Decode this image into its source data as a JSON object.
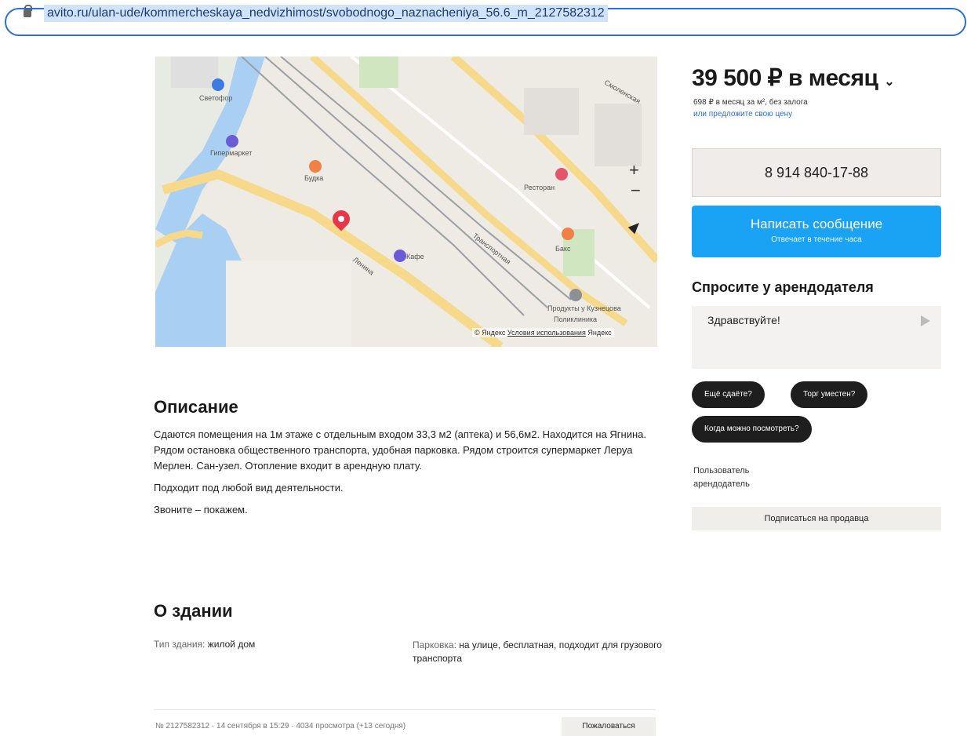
{
  "browser": {
    "url": "avito.ru/ulan-ude/kommercheskaya_nedvizhimost/svobodnogo_naznacheniya_56.6_m_2127582312"
  },
  "map": {
    "labels": [
      "Светофор",
      "Гипермаркет",
      "Будка",
      "Ленина",
      "Кафе",
      "Ресторан",
      "Продукты у Кузнецова",
      "Поликлиника",
      "Бакс",
      "Транспортная",
      "Смоленская"
    ],
    "zoom_in": "+",
    "zoom_out": "−",
    "copyright": "© Яндекс",
    "terms": "Условия использования",
    "brand": "Яндекс"
  },
  "sidebar": {
    "price": "39 500 ₽ в месяц",
    "price_sub": "698 ₽ в месяц за м², без залога",
    "price_link": "или предложите свою цену",
    "phone": "8 914 840-17-88",
    "message_button": "Написать сообщение",
    "message_button_sub": "Отвечает в течение часа",
    "ask_title": "Спросите у арендодателя",
    "ask_placeholder": "Здравствуйте!",
    "chips": [
      "Ещё сдаёте?",
      "Торг уместен?",
      "Когда можно посмотреть?"
    ],
    "seller_label": "Пользователь арендодатель",
    "subscribe_button": "Подписаться на продавца"
  },
  "description": {
    "title": "Описание",
    "paragraph1": "Сдаются помещения на 1м этаже с отдельным входом 33,3 м2 (аптека) и 56,6м2. Находится на Ягнина. Рядом остановка общественного транспорта, удобная парковка. Рядом строится супермаркет Леруа Мерлен. Сан-узел. Отопление входит в арендную плату.",
    "paragraph2": "Подходит под любой вид деятельности.",
    "paragraph3": "Звоните – покажем."
  },
  "building": {
    "title": "О здании",
    "type_label": "Тип здания:",
    "type_value": "жилой дом",
    "parking_label": "Парковка:",
    "parking_value": "на улице, бесплатная, подходит для грузового транспорта"
  },
  "footer": {
    "meta": "№ 2127582312 · 14 сентября в 15:29 · 4034 просмотра (+13 сегодня)",
    "complain_button": "Пожаловаться"
  }
}
